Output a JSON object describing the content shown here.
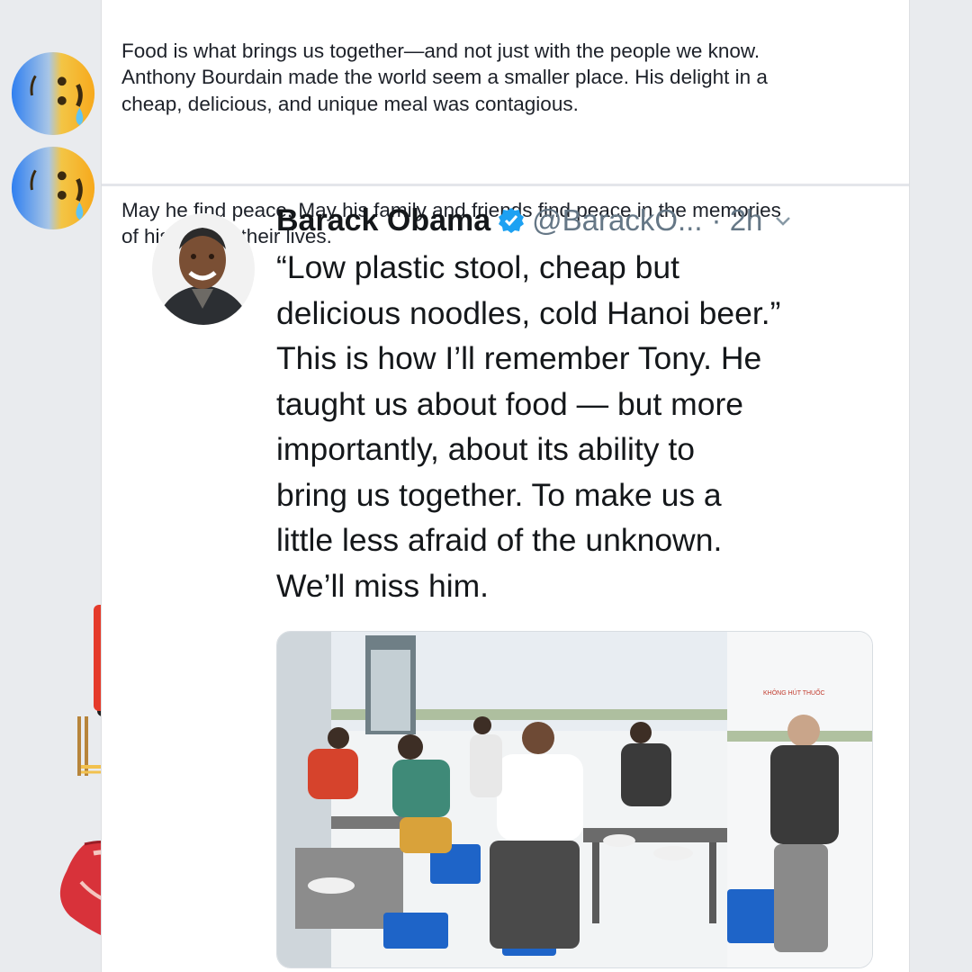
{
  "post": {
    "paragraph_1": "Food is what brings us together—and not just with the people we know.\nAnthony Bourdain made the world seem a smaller place. His delight in a\ncheap, delicious, and unique meal was contagious.",
    "paragraph_2": "May he find peace. May his family and friends find peace in the memories\nof his time in their lives."
  },
  "tweet": {
    "name": "Barack Obama",
    "handle": "@BarackO...",
    "time": "· 2h",
    "text": "“Low plastic stool, cheap but\ndelicious noodles, cold Hanoi beer.”\nThis is how I’ll remember Tony. He\ntaught us about food — but more\nimportantly, about its ability to\nbring us together. To make us a\nlittle less afraid of the unknown.\nWe’ll miss him.",
    "verified_color": "#1da1f2"
  },
  "photo": {
    "wall_sign": "KHÔNG HÚT THUỐC"
  },
  "emoji_column": [
    {
      "icon": "sad-relieved-face-icon"
    },
    {
      "icon": "sad-relieved-face-icon"
    },
    {
      "icon": "whiskey-glass-icon"
    },
    {
      "icon": "clinking-beer-mugs-icon"
    },
    {
      "icon": "bento-box-icon"
    },
    {
      "icon": "noodle-bowl-icon"
    },
    {
      "icon": "steak-icon"
    }
  ]
}
